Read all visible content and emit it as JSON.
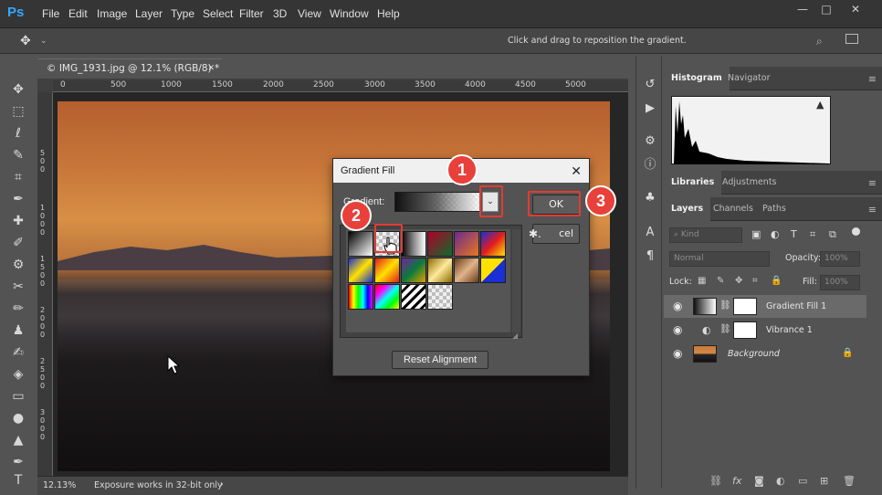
{
  "app": {
    "logo": "Ps",
    "menu": [
      "File",
      "Edit",
      "Image",
      "Layer",
      "Type",
      "Select",
      "Filter",
      "3D",
      "View",
      "Window",
      "Help"
    ],
    "window_controls": [
      "—",
      "□",
      "✕"
    ]
  },
  "options_bar": {
    "hint": "Click and drag to reposition the gradient."
  },
  "document": {
    "tab_title": "© IMG_1931.jpg @ 12.1% (RGB/8) *",
    "tab_close": "✕",
    "ruler_top": [
      "0",
      "500",
      "1000",
      "1500",
      "2000",
      "2500",
      "3000",
      "3500",
      "4000",
      "4500",
      "5000"
    ],
    "ruler_left": [
      "5",
      "0",
      "0",
      "1",
      "0",
      "0",
      "0",
      "1",
      "5",
      "0",
      "0",
      "2",
      "0",
      "0",
      "0",
      "2",
      "5",
      "0",
      "0",
      "3",
      "0",
      "0",
      "0"
    ],
    "status_zoom": "12.13%",
    "status_text": "Exposure works in 32-bit only",
    "status_arrow": "›"
  },
  "tools": [
    "move-icon",
    "marquee-icon",
    "lasso-icon",
    "quick-select-icon",
    "crop-icon",
    "eyedropper-icon",
    "healing-icon",
    "brush-icon",
    "clone-stamp-icon",
    "history-brush-icon",
    "eraser-icon",
    "gradient-icon",
    "blur-icon",
    "dodge-icon",
    "pen-icon",
    "type-icon"
  ],
  "panels": {
    "histogram_tabs": [
      "Histogram",
      "Navigator"
    ],
    "histogram_warning": "▲",
    "library_tabs": [
      "Libraries",
      "Adjustments"
    ],
    "layers_tabs": [
      "Layers",
      "Channels",
      "Paths"
    ],
    "filter_kind": "Kind",
    "blend_mode": "Normal",
    "opacity_label": "Opacity:",
    "opacity_value": "100%",
    "lock_label": "Lock:",
    "fill_label": "Fill:",
    "fill_value": "100%",
    "layers": [
      {
        "name": "Gradient Fill 1",
        "selected": true
      },
      {
        "name": "Vibrance 1",
        "selected": false
      },
      {
        "name": "Background",
        "selected": false
      }
    ]
  },
  "dialog": {
    "title": "Gradient Fill",
    "close": "✕",
    "gradient_label": "Gradient:",
    "dropdown_arrow": "⌄",
    "ok_label": "OK",
    "cancel_label": "cel",
    "reset_label": "Reset Alignment",
    "gear_label": "✱.",
    "swatches": [
      {
        "type": "linear-gradient(135deg,#000,#fff)"
      },
      {
        "type": "transparent-checker"
      },
      {
        "type": "linear-gradient(90deg,#000,#888,#fff)"
      },
      {
        "type": "linear-gradient(135deg,#b10026,#0d6b2e)"
      },
      {
        "type": "linear-gradient(135deg,#6b2a8c,#e87722)"
      },
      {
        "type": "linear-gradient(135deg,#1a2fd6,#e21c1c,#ffe200)"
      },
      {
        "type": "linear-gradient(135deg,#1a2fd6,#ffe200,#1a2fd6)"
      },
      {
        "type": "linear-gradient(135deg,#e21c1c,#ffe200,#e21c1c)"
      },
      {
        "type": "linear-gradient(135deg,#7a1fa2,#0b7a3a,#e2a000)"
      },
      {
        "type": "linear-gradient(135deg,#8c6b00,#ffe99a,#8c6b00)"
      },
      {
        "type": "linear-gradient(135deg,#6b3a1a,#e0b48a,#6b3a1a)"
      },
      {
        "type": "linear-gradient(135deg,#ffe200 0%,#ffe200 50%,#1a2fd6 50%,#1a2fd6 100%)"
      },
      {
        "type": "linear-gradient(90deg,#ff0000,#ffff00,#00ff00,#00ffff,#0000ff,#ff00ff)"
      },
      {
        "type": "linear-gradient(135deg,#ff0000,#ff00ff,#00ffff,#00ff00,#ffff00)"
      },
      {
        "type": "repeating-linear-gradient(135deg,#fff 0 4px,#000 4px 7px)"
      },
      {
        "type": "transparent-checker"
      }
    ]
  },
  "callouts": [
    "1",
    "2",
    "3"
  ],
  "colors": {
    "accent": "#31a8ff",
    "callout": "#e8403a",
    "highlight": "#e33b33"
  }
}
